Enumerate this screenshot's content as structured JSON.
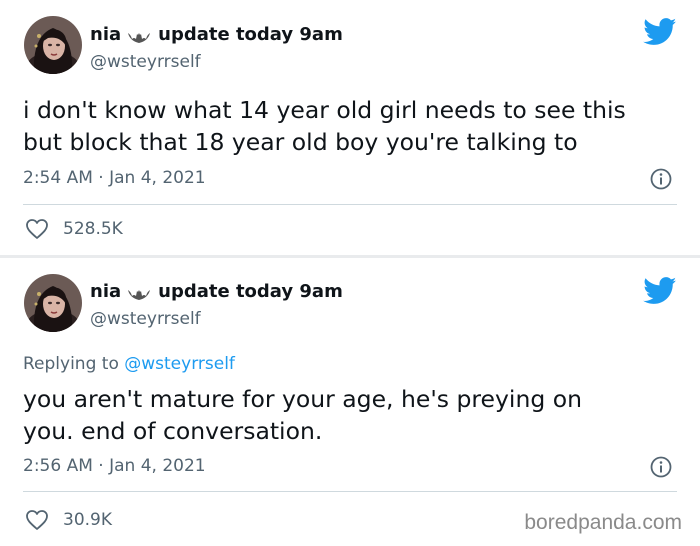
{
  "tweets": [
    {
      "display_name": "nia",
      "name_suffix": "update today 9am",
      "handle": "@wsteyrrself",
      "reply_to_prefix": "",
      "reply_to_handle": "",
      "text_line_1": "i don't know what 14 year old girl needs to see this",
      "text_line_2": "but block that 18 year old boy you're talking to",
      "timestamp": "2:54 AM · Jan 4, 2021",
      "likes": "528.5K"
    },
    {
      "display_name": "nia",
      "name_suffix": "update today 9am",
      "handle": "@wsteyrrself",
      "reply_to_prefix": "Replying to ",
      "reply_to_handle": "@wsteyrrself",
      "text_line_1": "you aren't mature for your age, he's preying on",
      "text_line_2": "you. end of conversation.",
      "timestamp": "2:56 AM · Jan 4, 2021",
      "likes": "30.9K"
    }
  ],
  "watermark": "boredpanda.com",
  "colors": {
    "twitter_blue": "#1d9bf0",
    "secondary_text": "#536471",
    "primary_text": "#0f1419"
  },
  "icons": [
    "bat-icon",
    "twitter-bird-icon",
    "info-icon",
    "heart-icon"
  ]
}
